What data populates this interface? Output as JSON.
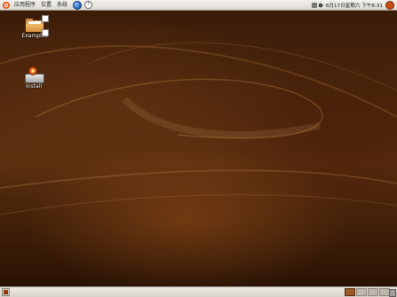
{
  "top_panel": {
    "menu": [
      {
        "id": "applications",
        "label": "应用程序"
      },
      {
        "id": "places",
        "label": "位置"
      },
      {
        "id": "system",
        "label": "系统"
      }
    ],
    "clock": "6月17日星期六 下午8:31"
  },
  "desktop": {
    "icons": [
      {
        "id": "examples",
        "label": "Examples",
        "icon": "folder-icon"
      },
      {
        "id": "install",
        "label": "Install",
        "icon": "installer-icon"
      }
    ],
    "wallpaper_color": "#4a250c",
    "accent_color": "#e05a1e"
  },
  "bottom_panel": {
    "workspaces": 4,
    "active_workspace": 1
  }
}
